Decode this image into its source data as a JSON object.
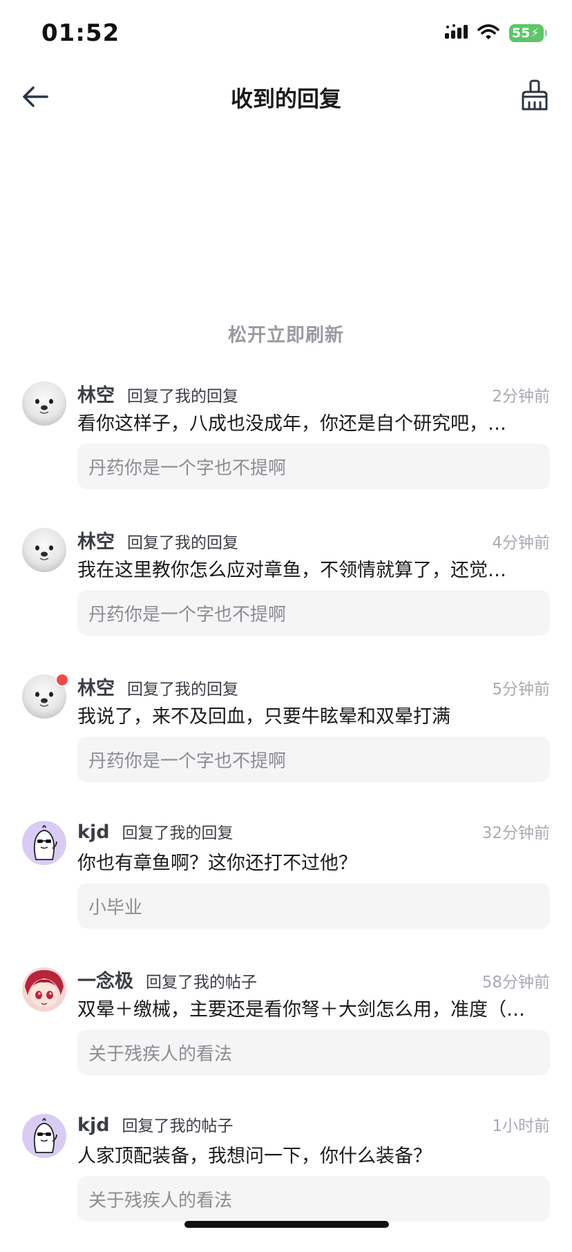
{
  "status_bar": {
    "time": "01:52",
    "battery_level": "55",
    "icons": [
      "signal-icon",
      "wifi-icon",
      "battery-icon"
    ]
  },
  "nav": {
    "title": "收到的回复",
    "back_icon": "back-arrow-icon",
    "clear_icon": "broom-icon"
  },
  "refresh_hint": "松开立即刷新",
  "colors": {
    "accent_red": "#f24a4a",
    "battery_green": "#5cc766",
    "quote_bg": "#f5f5f5",
    "muted_text": "#a8abb2"
  },
  "replies": [
    {
      "user": "林空",
      "type": "回复了我的回复",
      "time": "2分钟前",
      "text": "看你这样子，八成也没成年，你还是自个研究吧，…",
      "quote": "丹药你是一个字也不提啊",
      "avatar": "seal-avatar",
      "unread": false
    },
    {
      "user": "林空",
      "type": "回复了我的回复",
      "time": "4分钟前",
      "text": "我在这里教你怎么应对章鱼，不领情就算了，还觉…",
      "quote": "丹药你是一个字也不提啊",
      "avatar": "seal-avatar",
      "unread": false
    },
    {
      "user": "林空",
      "type": "回复了我的回复",
      "time": "5分钟前",
      "text": "我说了，来不及回血，只要牛眩晕和双晕打满",
      "quote": "丹药你是一个字也不提啊",
      "avatar": "seal-avatar",
      "unread": true
    },
    {
      "user": "kjd",
      "type": "回复了我的回复",
      "time": "32分钟前",
      "text": "你也有章鱼啊？这你还打不过他？",
      "quote": "小毕业",
      "avatar": "cartoon-avatar",
      "unread": false
    },
    {
      "user": "一念极",
      "type": "回复了我的帖子",
      "time": "58分钟前",
      "text": "双晕＋缴械，主要还是看你弩＋大剑怎么用，准度（…",
      "quote": "关于残疾人的看法",
      "avatar": "anime-avatar",
      "unread": false
    },
    {
      "user": "kjd",
      "type": "回复了我的帖子",
      "time": "1小时前",
      "text": "人家顶配装备，我想问一下，你什么装备？",
      "quote": "关于残疾人的看法",
      "avatar": "cartoon-avatar",
      "unread": false
    }
  ]
}
